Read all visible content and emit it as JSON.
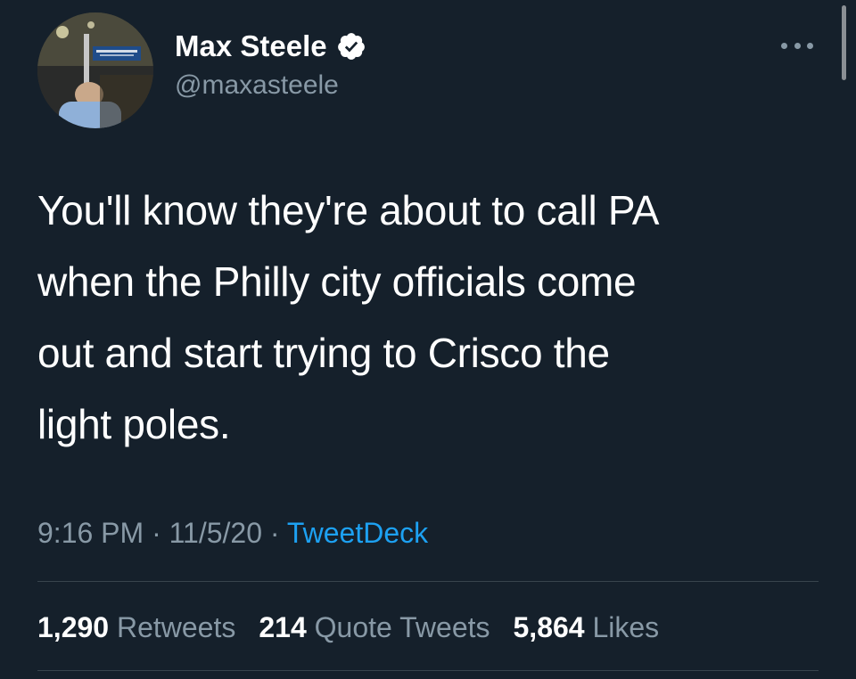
{
  "author": {
    "display_name": "Max Steele",
    "handle": "@maxasteele",
    "verified": true,
    "avatar_icon": "profile-photo"
  },
  "tweet": {
    "text": "You'll know they're about to call PA\nwhen the Philly city officials come\nout and start trying to Crisco the\nlight poles."
  },
  "meta": {
    "time": "9:16 PM",
    "separator": " · ",
    "date": "11/5/20",
    "source": "TweetDeck"
  },
  "stats": {
    "retweets_count": "1,290",
    "retweets_label": "Retweets",
    "quotes_count": "214",
    "quotes_label": "Quote Tweets",
    "likes_count": "5,864",
    "likes_label": "Likes"
  },
  "colors": {
    "background": "#15202b",
    "text_primary": "#ffffff",
    "text_secondary": "#8899a6",
    "link": "#1da1f2",
    "divider": "#38444d"
  }
}
